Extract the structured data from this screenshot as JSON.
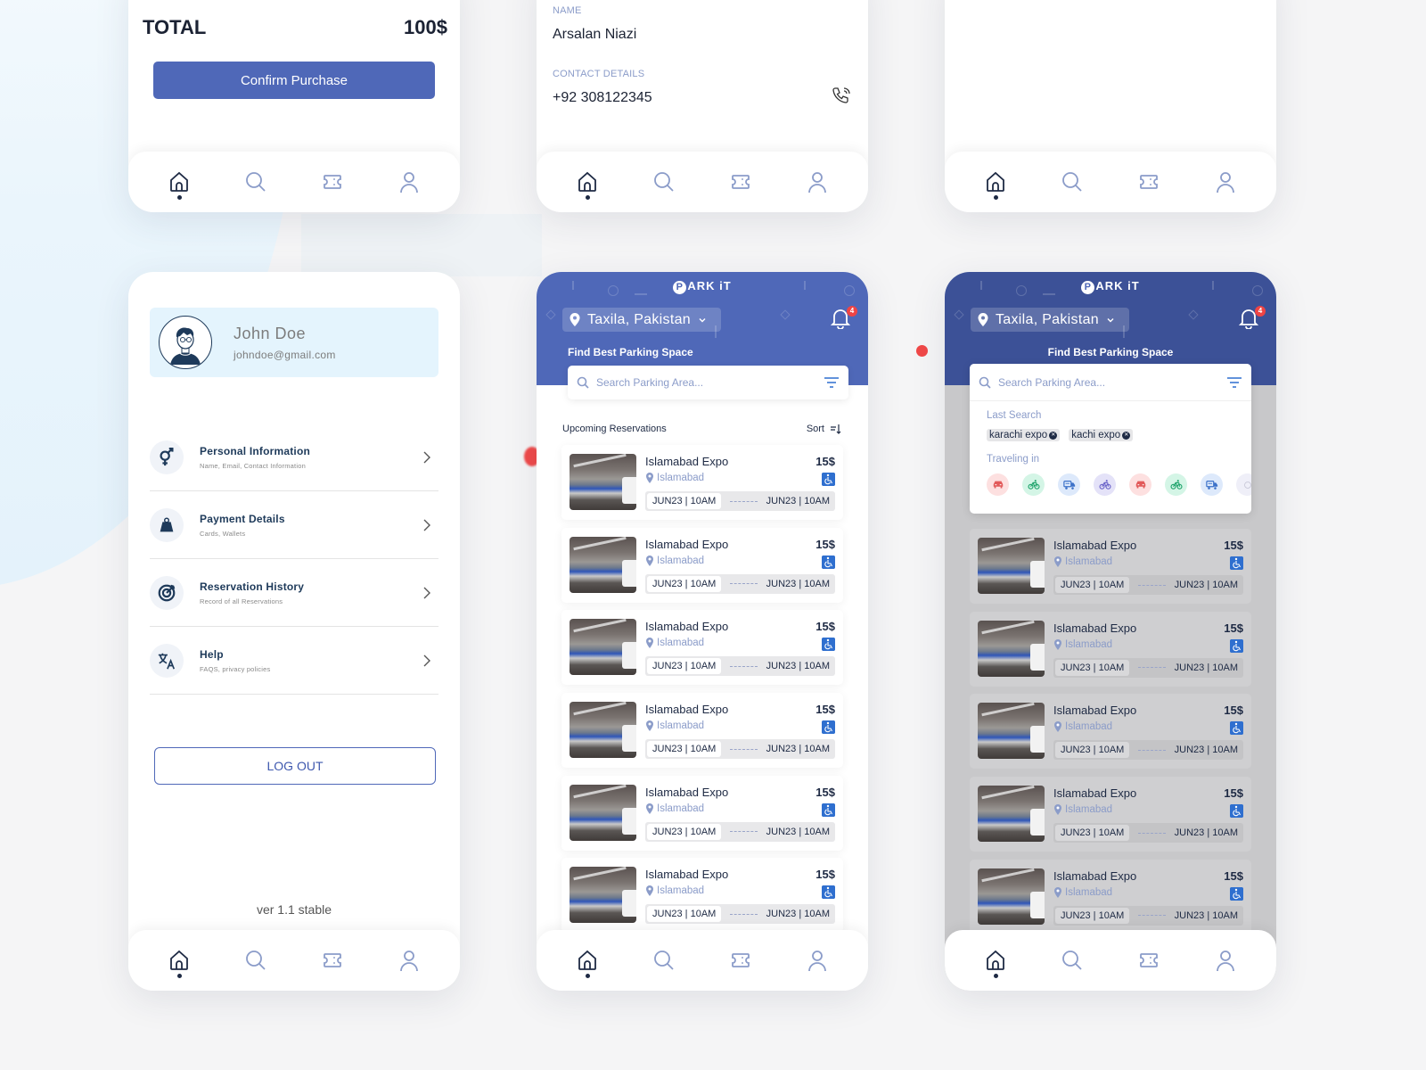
{
  "colors": {
    "primary": "#4f68b8",
    "dark_text": "#1e2a44",
    "muted_blue": "#8b9cc9",
    "badge_red": "#ef4444",
    "accessible_blue": "#2f6fcf"
  },
  "bottom_nav": {
    "items": [
      {
        "icon": "home-icon",
        "label": "Home",
        "active": true
      },
      {
        "icon": "search-icon",
        "label": "Search",
        "active": false
      },
      {
        "icon": "ticket-icon",
        "label": "Tickets",
        "active": false
      },
      {
        "icon": "user-icon",
        "label": "Profile",
        "active": false
      }
    ]
  },
  "checkout": {
    "total_label": "TOTAL",
    "total_value": "100$",
    "confirm_label": "Confirm Purchase"
  },
  "contact": {
    "name_label": "NAME",
    "name_value": "Arsalan Niazi",
    "contact_label": "CONTACT DETAILS",
    "contact_value": "+92 308122345",
    "call_icon": "phone-call-icon"
  },
  "profile": {
    "name": "John Doe",
    "email": "johndoe@gmail.com",
    "menu": [
      {
        "icon": "gender-icon",
        "title": "Personal Information",
        "subtitle": "Name, Email, Contact Information"
      },
      {
        "icon": "weight-bag-icon",
        "title": "Payment Details",
        "subtitle": "Cards, Wallets"
      },
      {
        "icon": "target-icon",
        "title": "Reservation History",
        "subtitle": "Record of all Reservations"
      },
      {
        "icon": "translate-icon",
        "title": "Help",
        "subtitle": "FAQS, privacy policies"
      }
    ],
    "logout_label": "LOG OUT",
    "version": "ver 1.1 stable"
  },
  "home": {
    "logo_letter": "P",
    "logo_rest": "ARK iT",
    "location": "Taxila, Pakistan",
    "notification_count": "4",
    "tagline": "Find Best Parking Space",
    "search_placeholder": "Search Parking Area...",
    "section_title": "Upcoming Reservations",
    "sort_label": "Sort",
    "reservations": [
      {
        "title": "Islamabad Expo",
        "price": "15$",
        "location": "Islamabad",
        "start": "JUN23 | 10AM",
        "end": "JUN23 | 10AM",
        "accessible": true
      },
      {
        "title": "Islamabad Expo",
        "price": "15$",
        "location": "Islamabad",
        "start": "JUN23 | 10AM",
        "end": "JUN23 | 10AM",
        "accessible": true
      },
      {
        "title": "Islamabad Expo",
        "price": "15$",
        "location": "Islamabad",
        "start": "JUN23 | 10AM",
        "end": "JUN23 | 10AM",
        "accessible": true
      },
      {
        "title": "Islamabad Expo",
        "price": "15$",
        "location": "Islamabad",
        "start": "JUN23 | 10AM",
        "end": "JUN23 | 10AM",
        "accessible": true
      },
      {
        "title": "Islamabad Expo",
        "price": "15$",
        "location": "Islamabad",
        "start": "JUN23 | 10AM",
        "end": "JUN23 | 10AM",
        "accessible": true
      },
      {
        "title": "Islamabad Expo",
        "price": "15$",
        "location": "Islamabad",
        "start": "JUN23 | 10AM",
        "end": "JUN23 | 10AM",
        "accessible": true
      }
    ]
  },
  "search_dropdown": {
    "last_search_label": "Last Search",
    "last_searches": [
      "karachi expo",
      "kachi expo"
    ],
    "traveling_label": "Traveling in",
    "vehicles": [
      {
        "type": "car",
        "bg": "#fde0e0",
        "fg": "#e25a5a"
      },
      {
        "type": "bicycle",
        "bg": "#d4f5e6",
        "fg": "#1fa36b"
      },
      {
        "type": "truck",
        "bg": "#dde9fb",
        "fg": "#3d72c9"
      },
      {
        "type": "bicycle",
        "bg": "#e4e2f8",
        "fg": "#6a63c9"
      },
      {
        "type": "car",
        "bg": "#fde0e0",
        "fg": "#e25a5a"
      },
      {
        "type": "bicycle",
        "bg": "#d4f5e6",
        "fg": "#1fa36b"
      },
      {
        "type": "truck",
        "bg": "#dde9fb",
        "fg": "#3d72c9"
      },
      {
        "type": "unknown",
        "bg": "#efeff8",
        "fg": "#c8c8d8"
      }
    ]
  }
}
